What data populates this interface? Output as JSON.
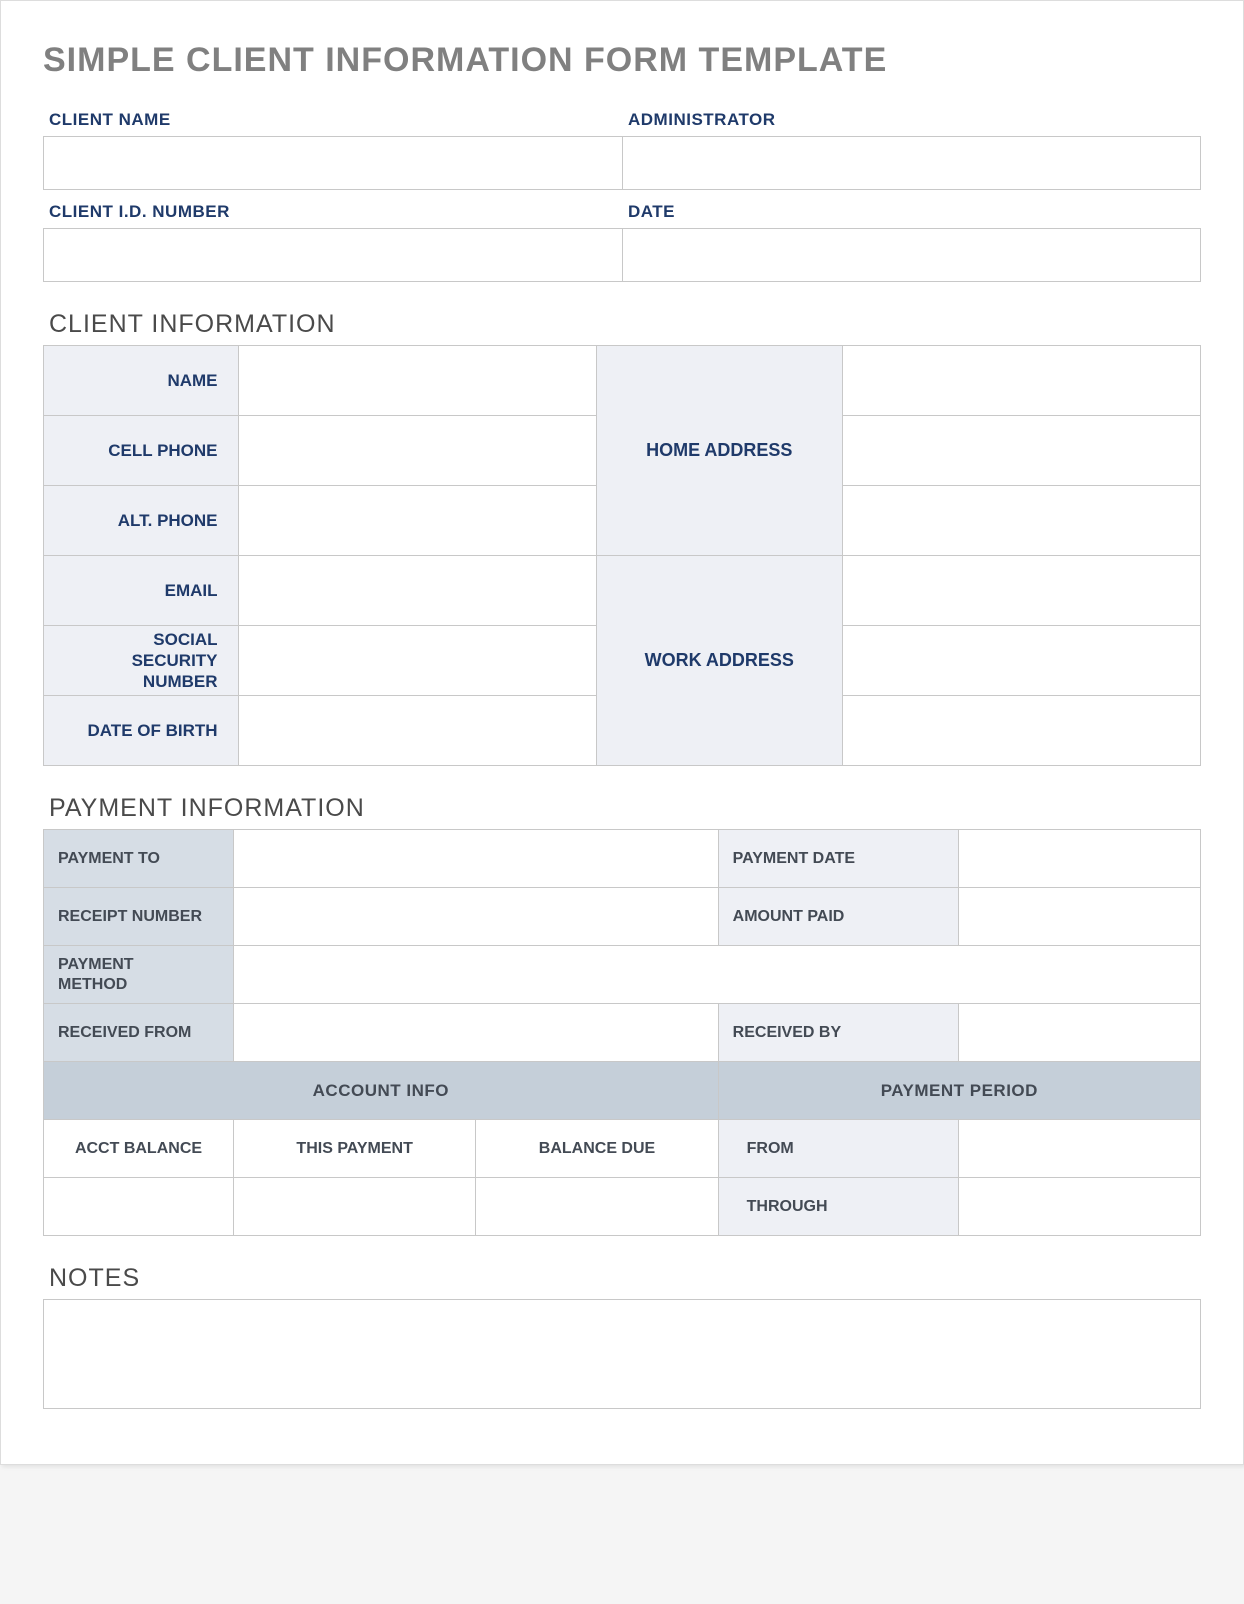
{
  "title": "SIMPLE CLIENT INFORMATION FORM TEMPLATE",
  "header": {
    "client_name_label": "CLIENT NAME",
    "client_name": "",
    "administrator_label": "ADMINISTRATOR",
    "administrator": "",
    "client_id_label": "CLIENT I.D. NUMBER",
    "client_id": "",
    "date_label": "DATE",
    "date": ""
  },
  "client_info": {
    "section_title": "CLIENT INFORMATION",
    "name_label": "NAME",
    "name": "",
    "cell_phone_label": "CELL PHONE",
    "cell_phone": "",
    "alt_phone_label": "ALT. PHONE",
    "alt_phone": "",
    "email_label": "EMAIL",
    "email": "",
    "ssn_label": "SOCIAL SECURITY NUMBER",
    "ssn": "",
    "dob_label": "DATE OF BIRTH",
    "dob": "",
    "home_address_label": "HOME ADDRESS",
    "home_address_1": "",
    "home_address_2": "",
    "home_address_3": "",
    "work_address_label": "WORK ADDRESS",
    "work_address_1": "",
    "work_address_2": "",
    "work_address_3": ""
  },
  "payment": {
    "section_title": "PAYMENT INFORMATION",
    "payment_to_label": "PAYMENT TO",
    "payment_to": "",
    "payment_date_label": "PAYMENT DATE",
    "payment_date": "",
    "receipt_number_label": "RECEIPT NUMBER",
    "receipt_number": "",
    "amount_paid_label": "AMOUNT PAID",
    "amount_paid": "",
    "payment_method_label": "PAYMENT METHOD",
    "payment_method": "",
    "received_from_label": "RECEIVED FROM",
    "received_from": "",
    "received_by_label": "RECEIVED BY",
    "received_by": "",
    "account_info_header": "ACCOUNT INFO",
    "payment_period_header": "PAYMENT PERIOD",
    "acct_balance_label": "ACCT BALANCE",
    "acct_balance": "",
    "this_payment_label": "THIS PAYMENT",
    "this_payment": "",
    "balance_due_label": "BALANCE DUE",
    "balance_due": "",
    "from_label": "FROM",
    "from": "",
    "through_label": "THROUGH",
    "through": ""
  },
  "notes": {
    "section_title": "NOTES",
    "value": ""
  }
}
